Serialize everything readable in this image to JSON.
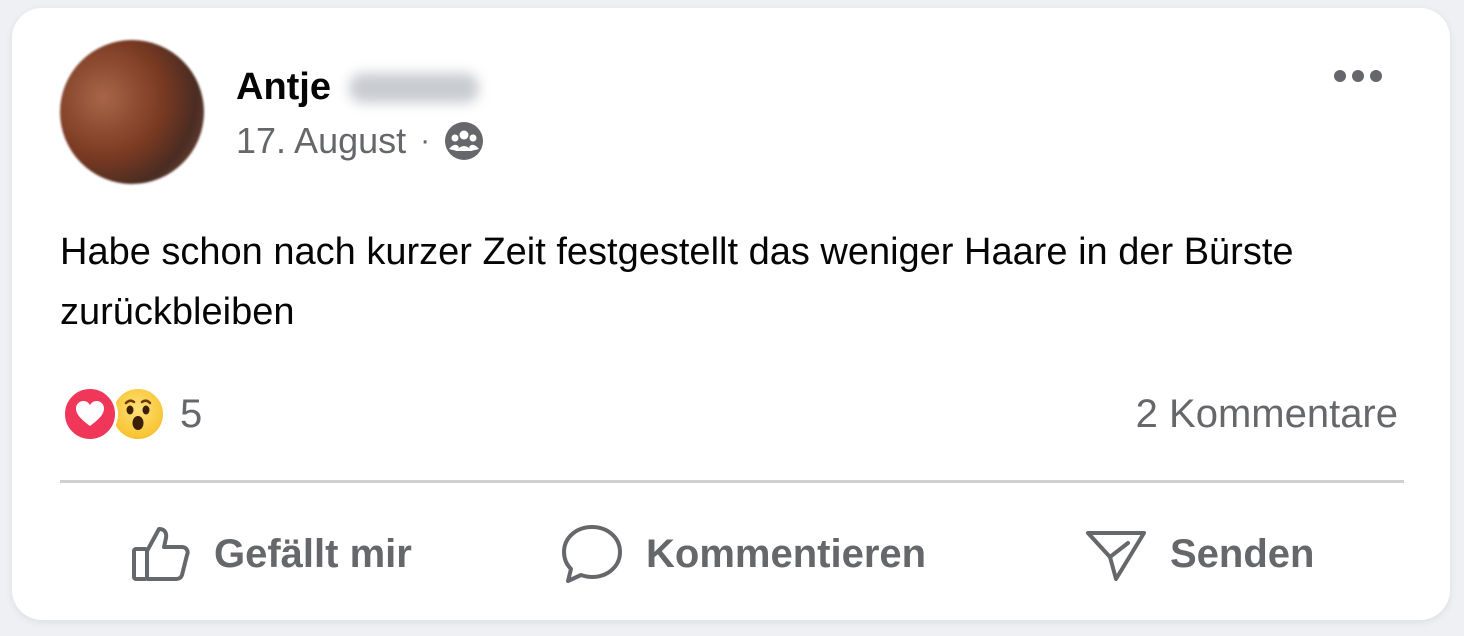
{
  "post": {
    "author_first_name": "Antje",
    "date": "17. August",
    "separator": "·",
    "audience_icon": "group-icon",
    "text": "Habe schon nach kurzer Zeit festgestellt das weniger Haare in der Bürste zurückbleiben"
  },
  "reactions": {
    "types": [
      "love",
      "wow"
    ],
    "count": "5"
  },
  "comments": {
    "label": "2 Kommentare"
  },
  "actions": {
    "like_label": "Gefällt mir",
    "comment_label": "Kommentieren",
    "share_label": "Senden"
  },
  "colors": {
    "text_primary": "#050505",
    "text_secondary": "#65676b",
    "love": "#f0375a",
    "wow": "#f8c533",
    "divider": "#ced0d4"
  }
}
